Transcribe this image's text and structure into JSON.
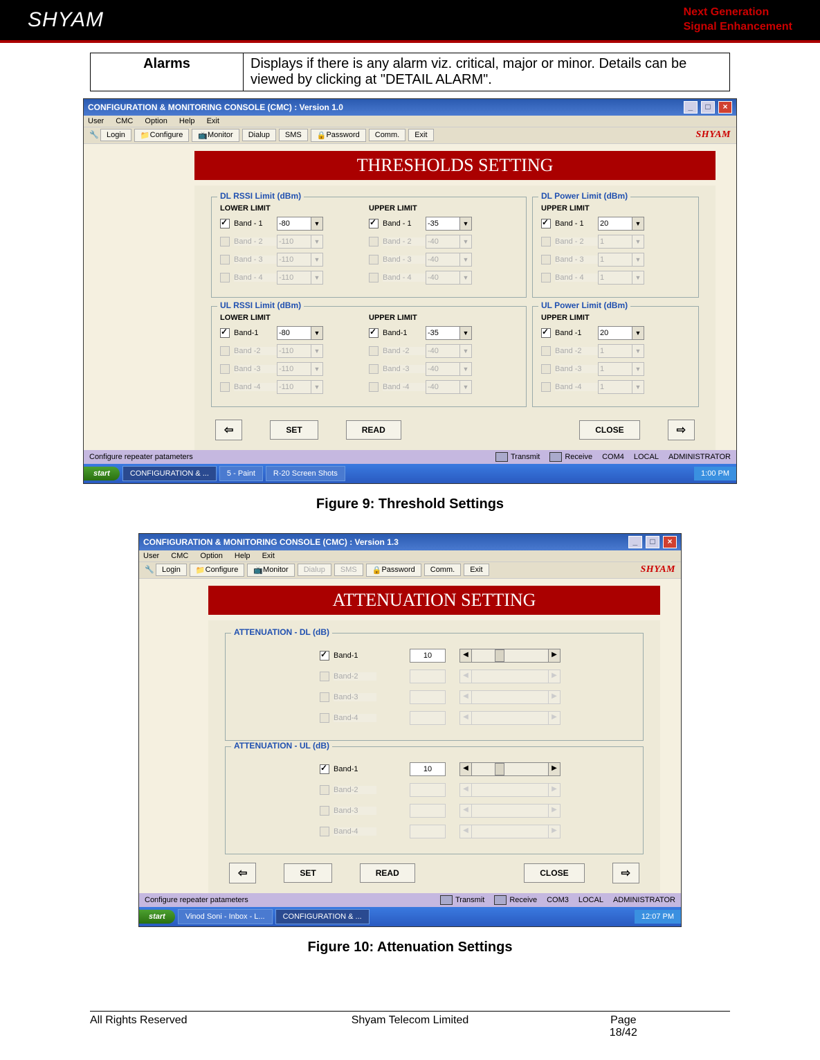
{
  "banner": {
    "logo": "SHYAM",
    "tag1": "Next Generation",
    "tag2": "Signal Enhancement"
  },
  "alarms_row": {
    "label": "Alarms",
    "desc": "Displays if there is any alarm viz. critical, major or minor. Details can be viewed by clicking at \"DETAIL ALARM\"."
  },
  "fig9": {
    "title": "CONFIGURATION & MONITORING CONSOLE (CMC)  :  Version 1.0",
    "menu": [
      "User",
      "CMC",
      "Option",
      "Help",
      "Exit"
    ],
    "toolbar": {
      "login": "Login",
      "configure": "Configure",
      "monitor": "Monitor",
      "dialup": "Dialup",
      "sms": "SMS",
      "password": "Password",
      "comm": "Comm.",
      "exit": "Exit",
      "brand": "SHYAM"
    },
    "header": "THRESHOLDS SETTING",
    "groups": {
      "dl_rssi": {
        "legend": "DL RSSI Limit (dBm)",
        "lower_head": "LOWER LIMIT",
        "upper_head": "UPPER LIMIT",
        "rows": [
          {
            "label": "Band - 1",
            "checked": true,
            "lower": "-80",
            "upper": "-35"
          },
          {
            "label": "Band - 2",
            "checked": false,
            "lower": "-110",
            "upper": "-40"
          },
          {
            "label": "Band - 3",
            "checked": false,
            "lower": "-110",
            "upper": "-40"
          },
          {
            "label": "Band - 4",
            "checked": false,
            "lower": "-110",
            "upper": "-40"
          }
        ]
      },
      "dl_pwr": {
        "legend": "DL Power Limit (dBm)",
        "upper_head": "UPPER LIMIT",
        "rows": [
          {
            "label": "Band - 1",
            "checked": true,
            "upper": "20"
          },
          {
            "label": "Band - 2",
            "checked": false,
            "upper": "1"
          },
          {
            "label": "Band - 3",
            "checked": false,
            "upper": "1"
          },
          {
            "label": "Band - 4",
            "checked": false,
            "upper": "1"
          }
        ]
      },
      "ul_rssi": {
        "legend": "UL RSSI Limit (dBm)",
        "lower_head": "LOWER LIMIT",
        "upper_head": "UPPER LIMIT",
        "rows": [
          {
            "label": "Band-1",
            "checked": true,
            "lower": "-80",
            "upper": "-35"
          },
          {
            "label": "Band -2",
            "checked": false,
            "lower": "-110",
            "upper": "-40"
          },
          {
            "label": "Band -3",
            "checked": false,
            "lower": "-110",
            "upper": "-40"
          },
          {
            "label": "Band -4",
            "checked": false,
            "lower": "-110",
            "upper": "-40"
          }
        ]
      },
      "ul_pwr": {
        "legend": "UL Power Limit (dBm)",
        "upper_head": "UPPER LIMIT",
        "rows": [
          {
            "label": "Band -1",
            "checked": true,
            "upper": "20"
          },
          {
            "label": "Band -2",
            "checked": false,
            "upper": "1"
          },
          {
            "label": "Band -3",
            "checked": false,
            "upper": "1"
          },
          {
            "label": "Band -4",
            "checked": false,
            "upper": "1"
          }
        ]
      }
    },
    "buttons": {
      "set": "SET",
      "read": "READ",
      "close": "CLOSE"
    },
    "status": {
      "left": "Configure repeater patameters",
      "transmit": "Transmit",
      "receive": "Receive",
      "com": "COM4",
      "local": "LOCAL",
      "role": "ADMINISTRATOR"
    },
    "taskbar": {
      "start": "start",
      "items": [
        "CONFIGURATION & ...",
        "5 - Paint",
        "R-20 Screen Shots"
      ],
      "tray": "1:00 PM"
    },
    "caption": "Figure 9: Threshold Settings"
  },
  "fig10": {
    "title": "CONFIGURATION & MONITORING CONSOLE (CMC)  :  Version 1.3",
    "menu": [
      "User",
      "CMC",
      "Option",
      "Help",
      "Exit"
    ],
    "toolbar": {
      "login": "Login",
      "configure": "Configure",
      "monitor": "Monitor",
      "dialup": "Dialup",
      "sms": "SMS",
      "password": "Password",
      "comm": "Comm.",
      "exit": "Exit",
      "brand": "SHYAM"
    },
    "header": "ATTENUATION SETTING",
    "dl": {
      "legend": "ATTENUATION - DL (dB)",
      "rows": [
        {
          "label": "Band-1",
          "checked": true,
          "val": "10"
        },
        {
          "label": "Band-2",
          "checked": false,
          "val": ""
        },
        {
          "label": "Band-3",
          "checked": false,
          "val": ""
        },
        {
          "label": "Band-4",
          "checked": false,
          "val": ""
        }
      ]
    },
    "ul": {
      "legend": "ATTENUATION - UL (dB)",
      "rows": [
        {
          "label": "Band-1",
          "checked": true,
          "val": "10"
        },
        {
          "label": "Band-2",
          "checked": false,
          "val": ""
        },
        {
          "label": "Band-3",
          "checked": false,
          "val": ""
        },
        {
          "label": "Band-4",
          "checked": false,
          "val": ""
        }
      ]
    },
    "buttons": {
      "set": "SET",
      "read": "READ",
      "close": "CLOSE"
    },
    "status": {
      "left": "Configure repeater patameters",
      "transmit": "Transmit",
      "receive": "Receive",
      "com": "COM3",
      "local": "LOCAL",
      "role": "ADMINISTRATOR"
    },
    "taskbar": {
      "start": "start",
      "items": [
        "Vinod Soni - Inbox - L...",
        "CONFIGURATION & ..."
      ],
      "tray": "12:07 PM"
    },
    "caption": "Figure 10: Attenuation Settings"
  },
  "footer": {
    "left": "All Rights Reserved",
    "center": "Shyam Telecom Limited",
    "page_lbl": "Page",
    "page": "18/42"
  }
}
